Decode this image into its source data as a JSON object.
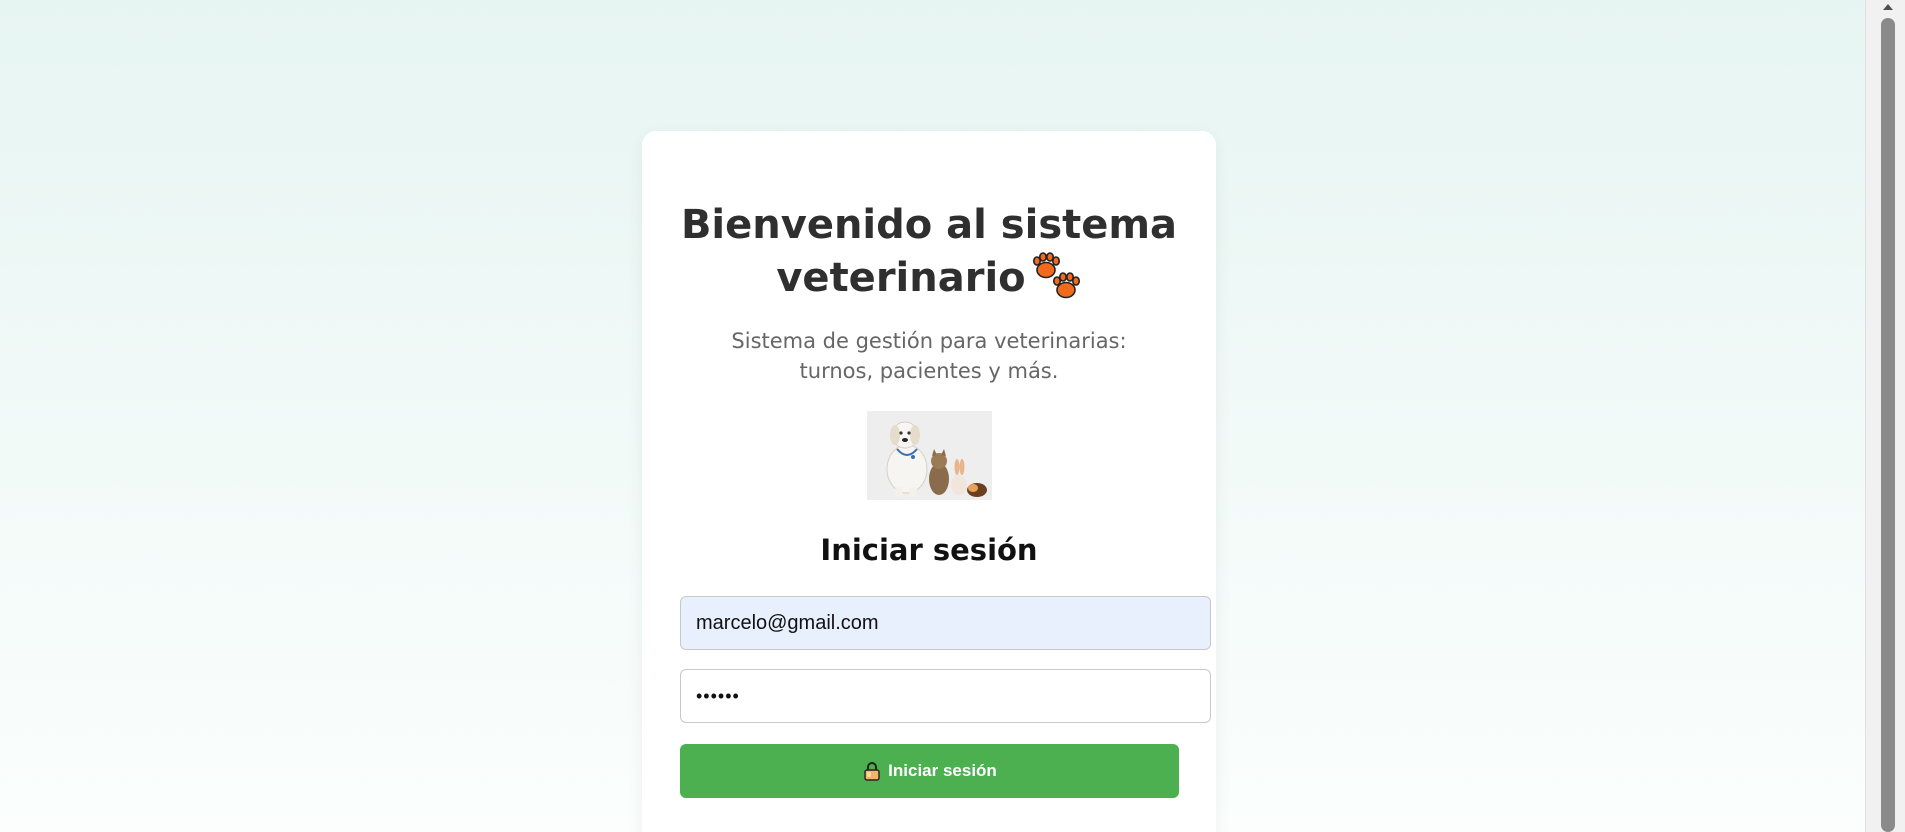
{
  "welcome": {
    "title_line1": "Bienvenido al sistema",
    "title_line2": "veterinario",
    "title_icon": "paw-prints-icon",
    "subtitle": "Sistema de gestión para veterinarias: turnos, pacientes y más."
  },
  "hero": {
    "image": "dog-cat-rabbit-guineapig-photo"
  },
  "login": {
    "heading": "Iniciar sesión",
    "email_value": "marcelo@gmail.com",
    "password_value": "••••••",
    "button_label": "Iniciar sesión",
    "button_icon": "lock-icon"
  },
  "colors": {
    "button_bg": "#4caf50",
    "email_autofill_bg": "#e8f0fe",
    "title_text": "#2f2f2f",
    "subtitle_text": "#666666"
  }
}
